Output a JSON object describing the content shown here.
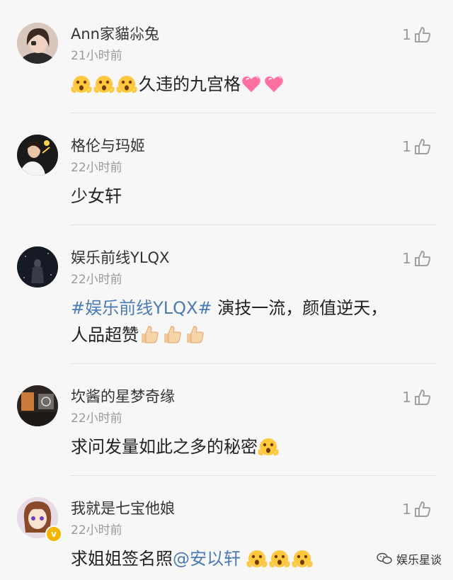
{
  "comments": [
    {
      "username": "Ann家貓尛兔",
      "time": "21小时前",
      "likes": "1",
      "before": "",
      "tag": "",
      "text": "久违的九宫格",
      "mention": "",
      "text2": "",
      "emoji_lead": [
        "shocked-face",
        "shocked-face",
        "shocked-face"
      ],
      "emoji_trail": [
        "pink-heart",
        "pink-heart"
      ]
    },
    {
      "username": "格伦与玛姬",
      "time": "22小时前",
      "likes": "1",
      "text": "少女轩"
    },
    {
      "username": "娱乐前线YLQX",
      "time": "22小时前",
      "likes": "1",
      "tag": "#娱乐前线YLQX#",
      "text": " 演技一流，颜值逆天，",
      "text2": "人品超赞",
      "emoji_trail": [
        "thumbs-up",
        "thumbs-up",
        "thumbs-up"
      ]
    },
    {
      "username": "坎酱的星梦奇缘",
      "time": "22小时前",
      "likes": "1",
      "text": "求问发量如此之多的秘密",
      "emoji_trail": [
        "shocked-face"
      ]
    },
    {
      "username": "我就是七宝他娘",
      "time": "22小时前",
      "likes": "1",
      "text": "求姐姐签名照",
      "mention": "@安以轩",
      "emoji_trail": [
        "shocked-face",
        "shocked-face",
        "shocked-face"
      ],
      "verified": "v"
    }
  ],
  "watermark": {
    "label": "娱乐星谈",
    "icon": "wechat-icon"
  },
  "colors": {
    "link": "#4a7bb5",
    "meta": "#9a9a9a",
    "background": "#f7f7f7"
  }
}
